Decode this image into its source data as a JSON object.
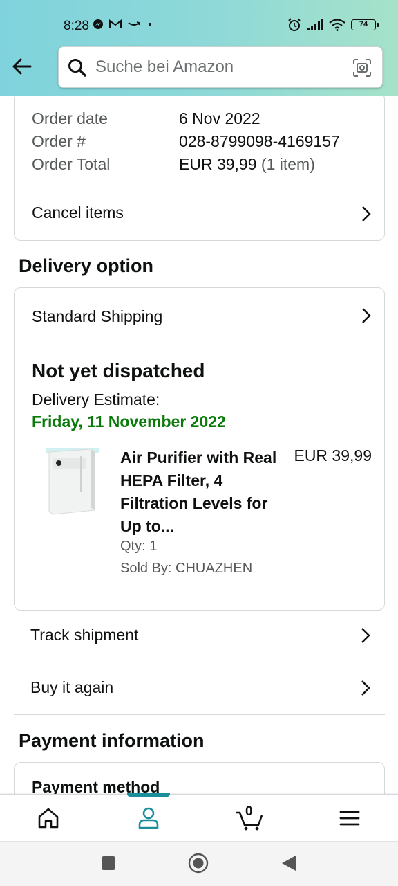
{
  "status_bar": {
    "time": "8:28",
    "battery": "74"
  },
  "search": {
    "placeholder": "Suche bei Amazon"
  },
  "order": {
    "rows": [
      {
        "label": "Order date",
        "value": "6 Nov 2022",
        "extra": ""
      },
      {
        "label": "Order #",
        "value": "028-8799098-4169157",
        "extra": ""
      },
      {
        "label": "Order Total",
        "value": "EUR 39,99",
        "extra": "(1 item)"
      }
    ],
    "cancel_label": "Cancel items"
  },
  "delivery": {
    "section_title": "Delivery option",
    "option": "Standard Shipping",
    "status": "Not yet dispatched",
    "estimate_label": "Delivery Estimate:",
    "estimate_date": "Friday, 11 November 2022",
    "estimate_color": "#0a7a0a",
    "product": {
      "title": "Air Purifier with Real HEPA Filter, 4 Filtration Levels for Up to...",
      "price": "EUR 39,99",
      "qty": "Qty: 1",
      "sold_by": "Sold By: CHUAZHEN"
    }
  },
  "actions": {
    "track": "Track shipment",
    "buy_again": "Buy it again"
  },
  "payment": {
    "section_title": "Payment information",
    "method_label": "Payment method"
  },
  "bottom_nav": {
    "items": [
      "home-icon",
      "account-icon",
      "cart-icon",
      "menu-icon"
    ],
    "active": "account-icon",
    "cart_count": "0",
    "accent": "#1a8f9b"
  },
  "system_nav": [
    "recents-icon",
    "home-circle-icon",
    "back-triangle-icon"
  ]
}
